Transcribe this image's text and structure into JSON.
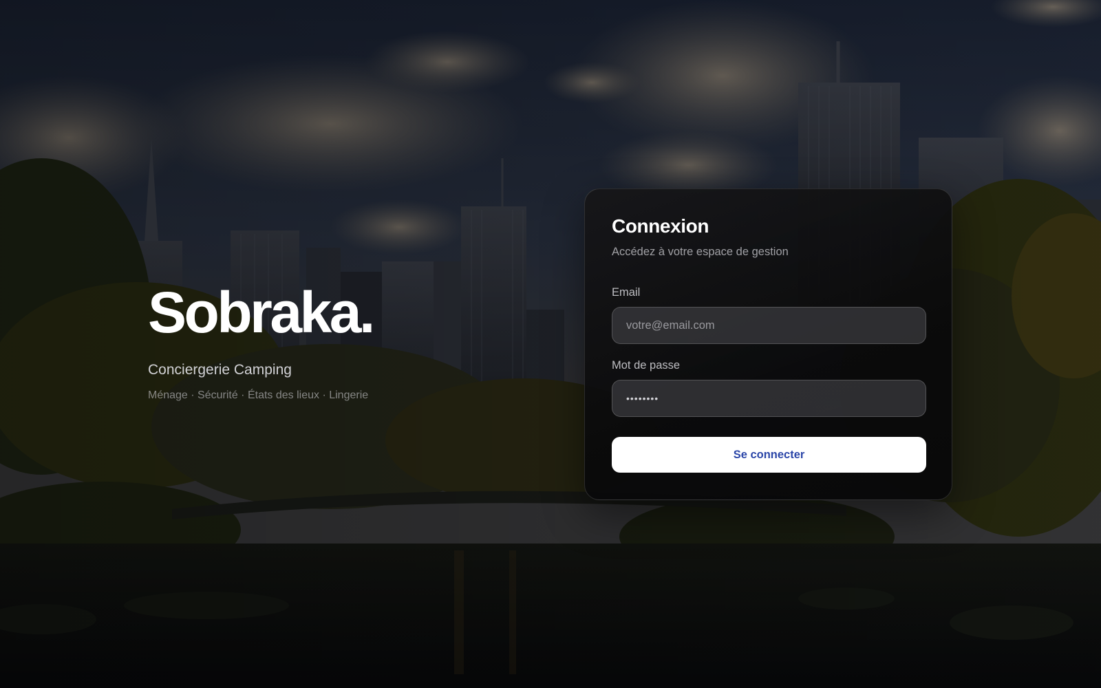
{
  "hero": {
    "brand": "Sobraka.",
    "tagline": "Conciergerie Camping",
    "services": "Ménage · Sécurité · États des lieux · Lingerie"
  },
  "login": {
    "title": "Connexion",
    "subtitle": "Accédez à votre espace de gestion",
    "email_label": "Email",
    "email_placeholder": "votre@email.com",
    "password_label": "Mot de passe",
    "password_value": "••••••••",
    "submit_label": "Se connecter"
  },
  "colors": {
    "button_text": "#2b46a8",
    "button_bg": "#ffffff",
    "card_bg": "#0c0c0d"
  }
}
